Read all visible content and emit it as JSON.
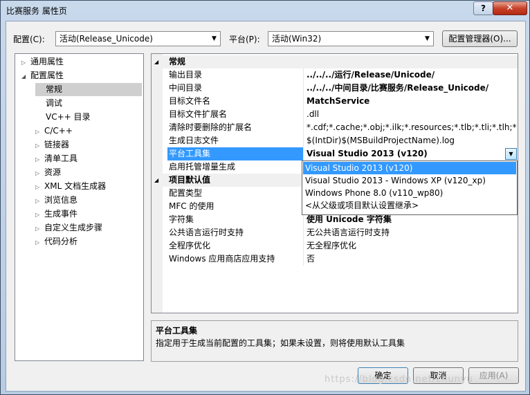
{
  "window": {
    "title": "比赛服务 属性页",
    "help_label": "?",
    "close_label": "✕"
  },
  "toolbar": {
    "config_label": "配置(C):",
    "config_value": "活动(Release_Unicode)",
    "platform_label": "平台(P):",
    "platform_value": "活动(Win32)",
    "config_manager_label": "配置管理器(O)..."
  },
  "tree": {
    "items": [
      {
        "label": "通用属性"
      },
      {
        "label": "配置属性"
      },
      {
        "label": "常规"
      },
      {
        "label": "调试"
      },
      {
        "label": "VC++ 目录"
      },
      {
        "label": "C/C++"
      },
      {
        "label": "链接器"
      },
      {
        "label": "清单工具"
      },
      {
        "label": "资源"
      },
      {
        "label": "XML 文档生成器"
      },
      {
        "label": "浏览信息"
      },
      {
        "label": "生成事件"
      },
      {
        "label": "自定义生成步骤"
      },
      {
        "label": "代码分析"
      }
    ]
  },
  "grid": {
    "cat1": "常规",
    "cat2": "项目默认值",
    "rows": [
      {
        "name": "输出目录",
        "value": "../../../运行/Release/Unicode/"
      },
      {
        "name": "中间目录",
        "value": "../../../中间目录/比赛服务/Release_Unicode/"
      },
      {
        "name": "目标文件名",
        "value": "MatchService"
      },
      {
        "name": "目标文件扩展名",
        "value": ".dll"
      },
      {
        "name": "清除时要删除的扩展名",
        "value": "*.cdf;*.cache;*.obj;*.ilk;*.resources;*.tlb;*.tli;*.tlh;*.tmp;*"
      },
      {
        "name": "生成日志文件",
        "value": "$(IntDir)$(MSBuildProjectName).log"
      },
      {
        "name": "平台工具集",
        "value": "Visual Studio 2013 (v120)"
      },
      {
        "name": "启用托管增量生成",
        "value": ""
      },
      {
        "name": "配置类型",
        "value": ""
      },
      {
        "name": "MFC 的使用",
        "value": ""
      },
      {
        "name": "字符集",
        "value": "使用 Unicode 字符集"
      },
      {
        "name": "公共语言运行时支持",
        "value": "无公共语言运行时支持"
      },
      {
        "name": "全程序优化",
        "value": "无全程序优化"
      },
      {
        "name": "Windows 应用商店应用支持",
        "value": "否"
      }
    ]
  },
  "dropdown": {
    "options": [
      "Visual Studio 2013 (v120)",
      "Visual Studio 2013 - Windows XP (v120_xp)",
      "Windows Phone 8.0 (v110_wp80)",
      "<从父级或项目默认设置继承>"
    ]
  },
  "description": {
    "title": "平台工具集",
    "text": "指定用于生成当前配置的工具集；如果未设置，则将使用默认工具集"
  },
  "buttons": {
    "ok": "确定",
    "cancel": "取消",
    "apply": "应用(A)"
  },
  "watermark": "https://blog.csdn.net/chunyu"
}
